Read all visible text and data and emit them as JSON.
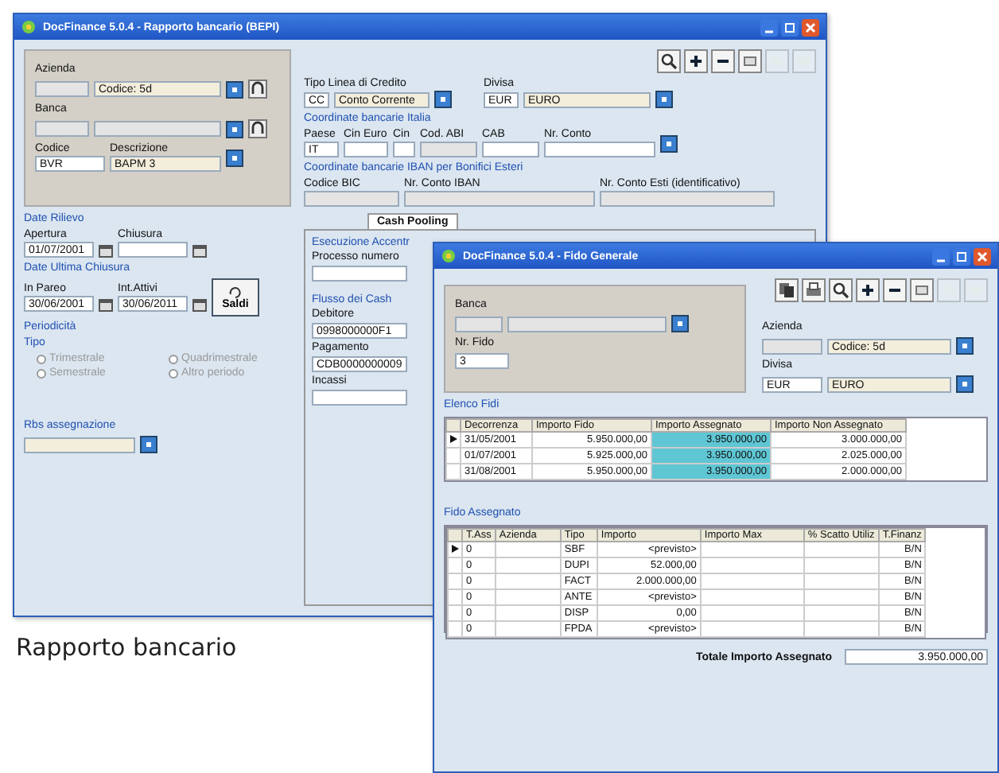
{
  "caption": "Rapporto bancario",
  "bank_window": {
    "title": "DocFinance 5.0.4 - Rapporto bancario (BEPI)",
    "azienda": {
      "label": "Azienda",
      "value": "Codice: 5d"
    },
    "banca": {
      "label": "Banca"
    },
    "codice": {
      "label": "Codice",
      "value": "BVR"
    },
    "descrizione": {
      "label": "Descrizione",
      "value": "BAPM 3"
    },
    "tipo_linea": {
      "label": "Tipo Linea di Credito",
      "code": "CC",
      "value": "Conto Corrente"
    },
    "divisa": {
      "label": "Divisa",
      "code": "EUR",
      "value": "EURO"
    },
    "italia": {
      "title": "Coordinate bancarie Italia",
      "fields": [
        {
          "label": "Paese",
          "value": "IT"
        },
        {
          "label": "Cin Euro"
        },
        {
          "label": "Cin"
        },
        {
          "label": "Cod. ABI"
        },
        {
          "label": "CAB"
        },
        {
          "label": "Nr. Conto"
        }
      ]
    },
    "iban": {
      "title": "Coordinate bancarie IBAN per Bonifici Esteri",
      "fields": [
        {
          "label": "Codice BIC"
        },
        {
          "label": "Nr. Conto IBAN"
        },
        {
          "label": "Nr. Conto Esti (identificativo)"
        }
      ]
    },
    "date_rilievo": {
      "title": "Date Rilievo",
      "apertura": {
        "label": "Apertura",
        "value": "01/07/2001"
      },
      "chiusura": {
        "label": "Chiusura"
      }
    },
    "ultima_chiusura": {
      "title": "Date Ultima Chiusura",
      "fields": [
        {
          "label": "In Pareo",
          "value": "30/06/2001"
        },
        {
          "label": "Int.Attivi",
          "value": "30/06/2011"
        }
      ],
      "button": "Saldi"
    },
    "periodicita": {
      "title": "Periodicità",
      "subtitle": "Tipo",
      "options": [
        {
          "label": "Trimestrale",
          "selected": false,
          "disabled": true
        },
        {
          "label": "Quadrimestrale",
          "selected": false,
          "disabled": true
        },
        {
          "label": "Semestrale",
          "selected": false,
          "disabled": true
        },
        {
          "label": "Altro periodo",
          "selected": false,
          "disabled": true
        }
      ]
    },
    "assegnazione": {
      "title": "Rbs assegnazione"
    },
    "tabs": [
      {
        "label": "Cash Pooling",
        "selected": true
      }
    ],
    "cash": {
      "title": "Esecuzione Accentr",
      "processo": "Processo numero",
      "flusso": "Flusso dei Cash",
      "fields": [
        {
          "label": "Debitore",
          "value": "0998000000F1"
        },
        {
          "label": "Pagamento",
          "value": "CDB0000000009"
        },
        {
          "label": "Incassi"
        }
      ]
    }
  },
  "credit_window": {
    "title": "DocFinance 5.0.4 - Fido Generale",
    "banca": {
      "label": "Banca"
    },
    "nr_fido": {
      "label": "Nr. Fido",
      "value": "3"
    },
    "azienda": {
      "label": "Azienda",
      "value": "Codice: 5d"
    },
    "divisa": {
      "label": "Divisa",
      "code": "EUR",
      "value": "EURO"
    },
    "fidi": {
      "title": "Elenco Fidi",
      "columns": [
        "Decorrenza",
        "Importo Fido",
        "Importo Assegnato",
        "Importo Non Assegnato"
      ],
      "rows": [
        {
          "selected": true,
          "cells": [
            "31/05/2001",
            "5.950.000,00",
            "3.950.000,00",
            "3.000.000,00"
          ]
        },
        {
          "selected": false,
          "cells": [
            "01/07/2001",
            "5.925.000,00",
            "3.950.000,00",
            "2.025.000,00"
          ]
        },
        {
          "selected": false,
          "cells": [
            "31/08/2001",
            "5.950.000,00",
            "3.950.000,00",
            "2.000.000,00"
          ]
        }
      ]
    },
    "assegnati": {
      "title": "Fido Assegnato",
      "columns": [
        "T.Ass",
        "Azienda",
        "Tipo",
        "Importo",
        "Importo Max",
        "% Scatto Utiliz",
        "T.Finanz"
      ],
      "rows": [
        {
          "selected": true,
          "cells": [
            "0",
            "",
            "SBF",
            "<previsto>",
            "",
            "",
            "B/N"
          ]
        },
        {
          "selected": false,
          "cells": [
            "0",
            "",
            "DUPI",
            "52.000,00",
            "",
            "",
            "B/N"
          ]
        },
        {
          "selected": false,
          "cells": [
            "0",
            "",
            "FACT",
            "2.000.000,00",
            "",
            "",
            "B/N"
          ]
        },
        {
          "selected": false,
          "cells": [
            "0",
            "",
            "ANTE",
            "<previsto>",
            "",
            "",
            "B/N"
          ]
        },
        {
          "selected": false,
          "cells": [
            "0",
            "",
            "DISP",
            "0,00",
            "",
            "",
            "B/N"
          ]
        },
        {
          "selected": false,
          "cells": [
            "0",
            "",
            "FPDA",
            "<previsto>",
            "",
            "",
            "B/N"
          ]
        }
      ]
    },
    "total": {
      "label": "Totale Importo Assegnato",
      "value": "3.950.000,00"
    }
  }
}
